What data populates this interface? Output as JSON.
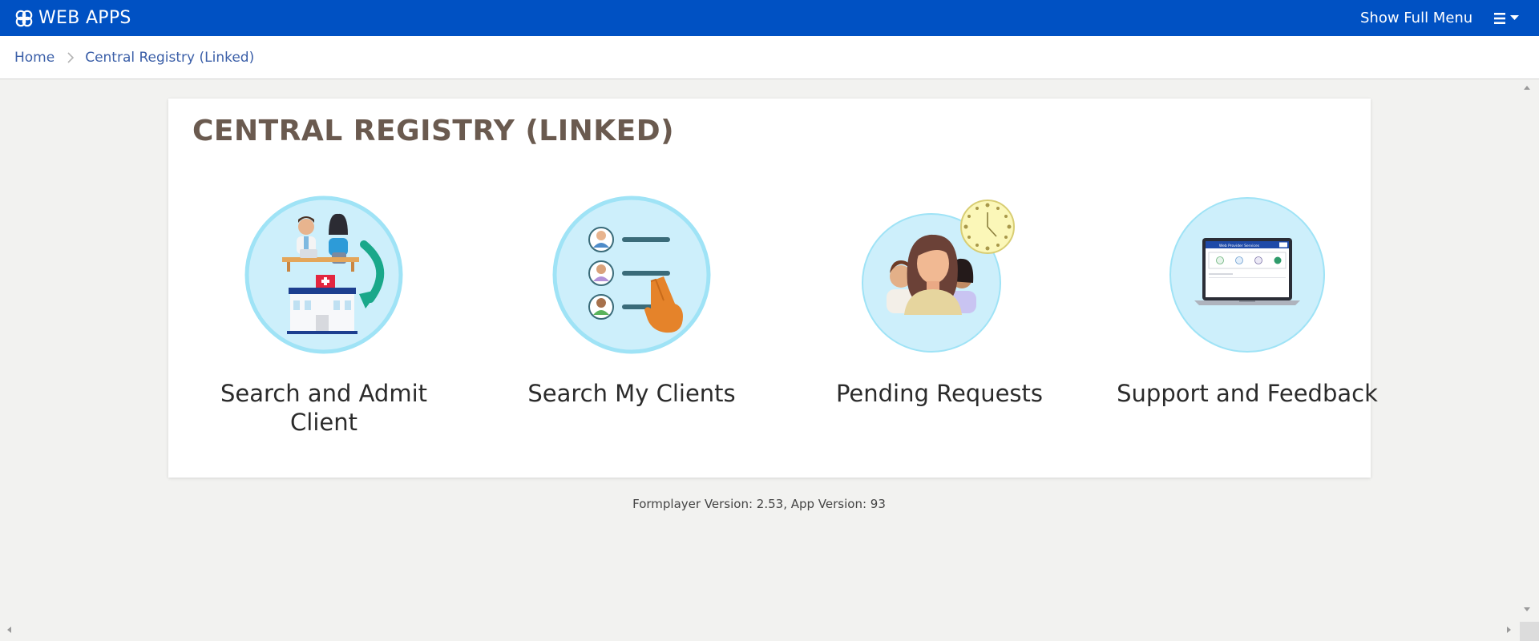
{
  "topbar": {
    "brand": "WEB APPS",
    "show_full_menu": "Show Full Menu",
    "menu_icon": "hamburger-icon"
  },
  "breadcrumb": {
    "items": [
      "Home",
      "Central Registry (Linked)"
    ]
  },
  "main": {
    "title": "CENTRAL REGISTRY (LINKED)",
    "tiles": [
      {
        "label": "Search and Admit Client",
        "icon": "hospital-admit-icon"
      },
      {
        "label": "Search My Clients",
        "icon": "client-list-icon"
      },
      {
        "label": "Pending Requests",
        "icon": "pending-requests-icon"
      },
      {
        "label": "Support and Feedback",
        "icon": "laptop-support-icon"
      }
    ],
    "laptop_screen_title": "Web Provider Services"
  },
  "footer": {
    "version": "Formplayer Version: 2.53, App Version: 93"
  },
  "colors": {
    "topbar": "#0051c3",
    "title": "#6a5a4f",
    "link": "#3b5fa8",
    "circle_fill": "#cdeffb",
    "circle_border": "#9fe3f6",
    "accent_orange": "#e5832a",
    "accent_green": "#1aa88a"
  }
}
